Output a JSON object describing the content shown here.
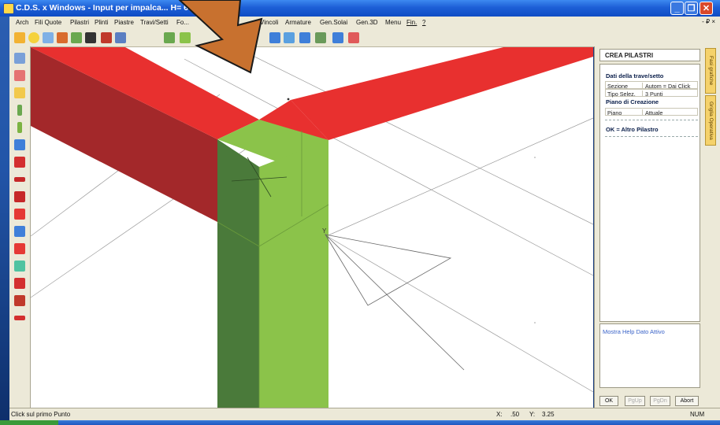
{
  "window": {
    "title": "C.D.S. x Windows - Input per impalca... H= 6 m",
    "buttons": {
      "minimize": "_",
      "maximize": "❐",
      "close": "✕"
    }
  },
  "menu": {
    "items": [
      "Arch",
      "Fili Quote",
      "Pilastri",
      "Plinti",
      "Piastre",
      "Travi/Setti",
      "Fo...",
      "Vincoli",
      "Armature",
      "Gen.Solai",
      "Gen.3D",
      "Menu",
      "Fin.",
      "?"
    ],
    "mdi_controls": "- ₽ ×"
  },
  "toolbar": {
    "icons": [
      "grid-icon",
      "sun-icon",
      "zoom-icon",
      "wall-icon",
      "tool-icon",
      "camera-icon",
      "save-icon",
      "building-icon",
      "column-icon",
      "person-icon",
      "beam-icon",
      "stair-icon",
      "slab-icon",
      "table-icon",
      "print-icon"
    ]
  },
  "left_tools": {
    "icons": [
      "select-icon",
      "node-icon",
      "ruler-icon",
      "column-green-icon",
      "column-red-icon",
      "plinth-icon",
      "beam-red-icon",
      "beam-line-icon",
      "wall-icon",
      "slab-red-icon",
      "slab-blue-icon",
      "slope-icon",
      "panel-icon",
      "stair-icon",
      "rebar-icon",
      "curve-icon"
    ]
  },
  "panel": {
    "header": "CREA PILASTRI",
    "section1_title": "Dati della trave/setto",
    "rows1": [
      {
        "key": "Sezione",
        "value": "Autom = Dai Click"
      },
      {
        "key": "Tipo Selez.",
        "value": "3 Punti"
      }
    ],
    "section2_title": "Piano di Creazione",
    "rows2": [
      {
        "key": "Piano",
        "value": "Attuale"
      }
    ],
    "ok_text": "OK = Altro Pilastro",
    "help_link": "Mostra Help Dato Attivo",
    "buttons": {
      "ok": "OK",
      "prev": "PgUp",
      "next": "PgDn",
      "abort": "Abort"
    }
  },
  "side_tabs": [
    "Fasi grafiche",
    "Griglia Operativa"
  ],
  "status": {
    "message": "Click sul primo Punto",
    "x_label": "X:",
    "x_value": ".50",
    "y_label": "Y:",
    "y_value": "3.25",
    "num": "NUM"
  },
  "colors": {
    "beam_red": "#e8302f",
    "beam_red_dark": "#a3282a",
    "column_green": "#8bc34a",
    "column_green_dark": "#4a7a3a",
    "arrow": "#c8712f"
  }
}
